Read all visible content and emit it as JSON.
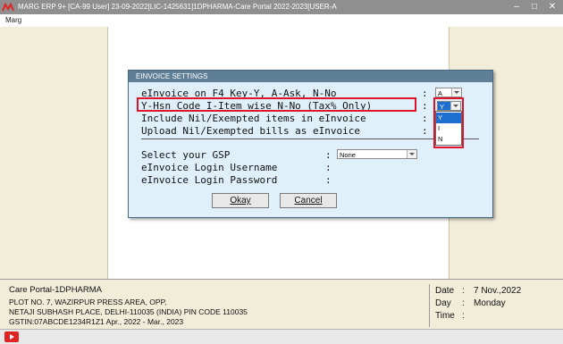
{
  "window": {
    "title": "MARG ERP 9+ [CA-99 User] 23-09-2022[LIC-1425631]1DPHARMA-Care Portal 2022-2023[USER-A",
    "menu": "Marg"
  },
  "dialog": {
    "title": "EINVOICE SETTINGS",
    "rows": [
      {
        "label": "eInvoice on F4 Key-Y, A-Ask, N-No",
        "value": "A"
      },
      {
        "label": "Y-Hsn Code I-Item wise N-No (Tax% Only)",
        "value": "Y"
      },
      {
        "label": "Include Nil/Exempted items in eInvoice",
        "value": ""
      },
      {
        "label": "Upload Nil/Exempted bills as eInvoice",
        "value": ""
      }
    ],
    "gsp_label": "Select your GSP",
    "gsp_value": "None",
    "username_label": "eInvoice Login Username",
    "password_label": "eInvoice Login Password",
    "dropdown_options": [
      "Y",
      "I",
      "N"
    ],
    "okay_label": "Okay",
    "cancel_label": "Cancel"
  },
  "footer": {
    "company": "Care Portal-1DPHARMA",
    "address1": "PLOT NO. 7, WAZIRPUR PRESS AREA, OPP,",
    "address2": "NETAJI SUBHASH PLACE, DELHI-110035 (INDIA) PIN CODE 110035",
    "gstin": "GSTIN:07ABCDE1234R1Z1  Apr., 2022 - Mar., 2023",
    "date_label": "Date",
    "date_value": "7 Nov.,2022",
    "day_label": "Day",
    "day_value": "Monday",
    "time_label": "Time",
    "time_value": ""
  },
  "colors": {
    "highlight": "#e0132b",
    "dialog_bg": "#dff0fa",
    "dialog_title_bg": "#5f7f97",
    "panel_bg": "#f1edd9",
    "selected_option": "#1e6fd0"
  }
}
